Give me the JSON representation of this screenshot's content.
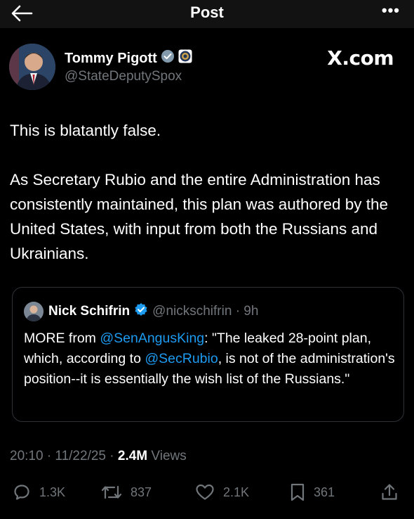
{
  "header": {
    "title": "Post"
  },
  "post": {
    "author_name": "Tommy Pigott",
    "author_handle": "@StateDeputySpox",
    "watermark": "X.com",
    "paragraphs": [
      "This is blatantly false.",
      "As Secretary Rubio and the entire Administration has consistently maintained, this plan was authored by the United States, with input from both the Russians and Ukrainians."
    ]
  },
  "quote": {
    "name": "Nick Schifrin",
    "handle_time": "@nickschifrin · 9h",
    "text_1": "MORE from ",
    "mention_1": "@SenAngusKing",
    "text_2": ": \"The leaked 28-point plan, which, according to ",
    "mention_2": "@SecRubio",
    "text_3": ", is not of the administration's position--it is essentially the wish list of the Russians.\""
  },
  "meta": {
    "timestamp": "20:10 · 11/22/25 · ",
    "views_count": "2.4M",
    "views_label": " Views"
  },
  "actions": {
    "replies": "1.3K",
    "reposts": "837",
    "likes": "2.1K",
    "bookmarks": "361"
  },
  "colors": {
    "background": "#000000",
    "accent": "#1d9bf0",
    "muted": "#71767b",
    "verified": "#1d9bf0"
  }
}
